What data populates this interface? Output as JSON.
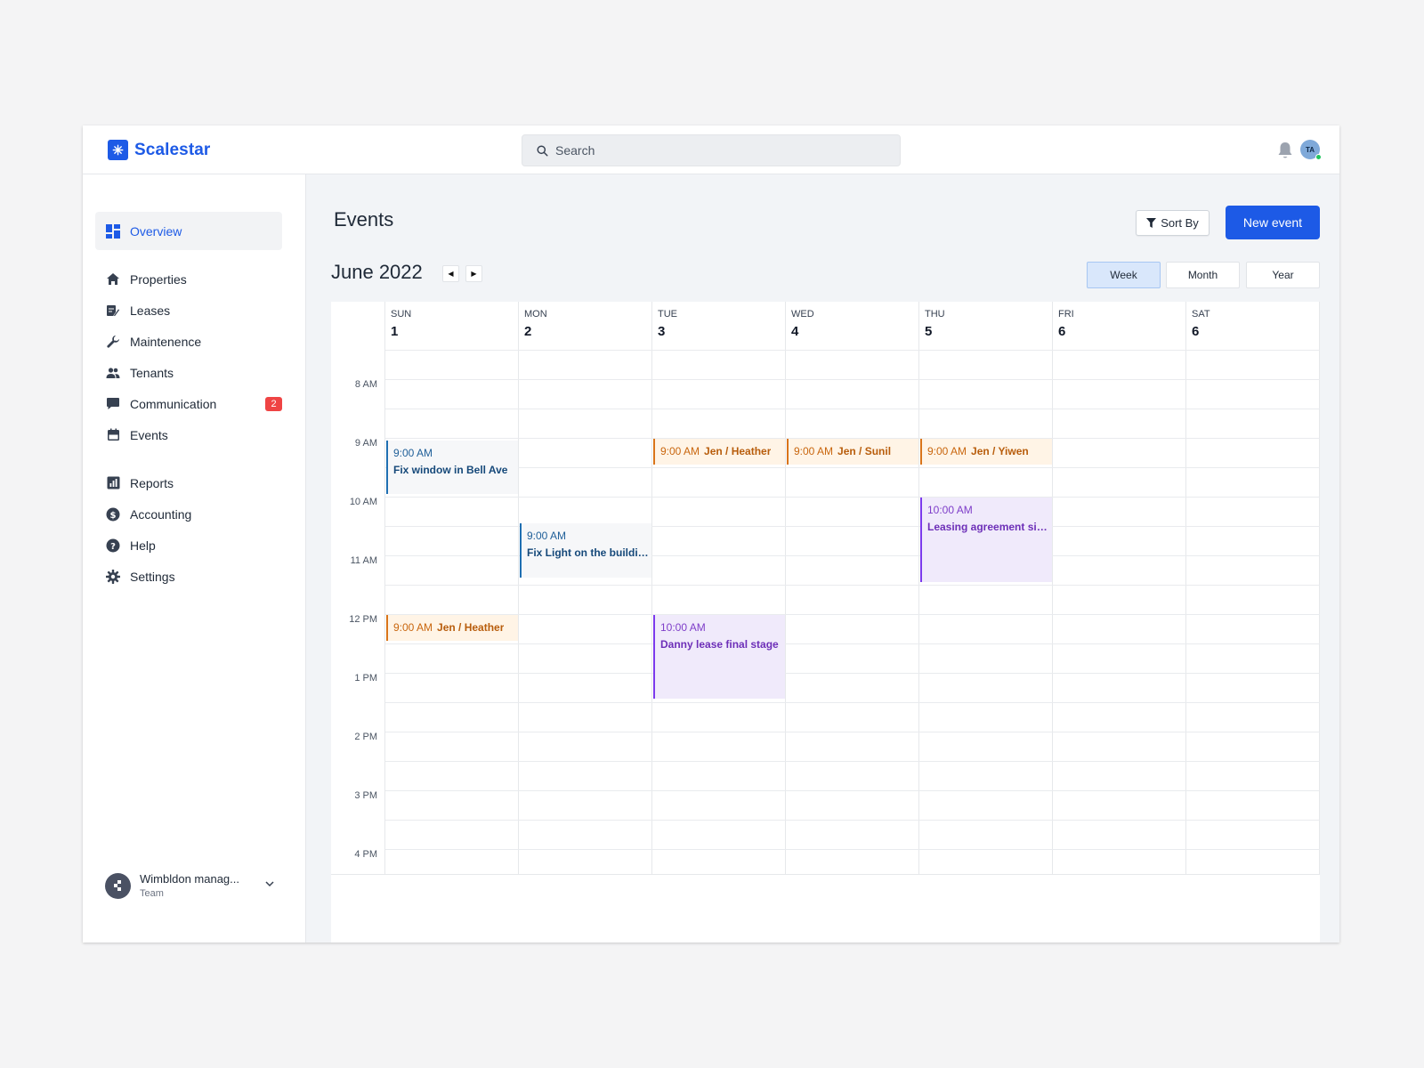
{
  "app": {
    "name": "Scalestar"
  },
  "search": {
    "placeholder": "Search"
  },
  "user": {
    "initials": "TA"
  },
  "sidebar": {
    "items": [
      {
        "label": "Overview",
        "icon": "grid-icon"
      },
      {
        "label": "Properties",
        "icon": "home-icon"
      },
      {
        "label": "Leases",
        "icon": "document-edit-icon"
      },
      {
        "label": "Maintenence",
        "icon": "wrench-icon"
      },
      {
        "label": "Tenants",
        "icon": "people-icon"
      },
      {
        "label": "Communication",
        "icon": "chat-icon",
        "badge": "2"
      },
      {
        "label": "Events",
        "icon": "calendar-icon"
      },
      {
        "label": "Reports",
        "icon": "bar-chart-icon"
      },
      {
        "label": "Accounting",
        "icon": "dollar-icon"
      },
      {
        "label": "Help",
        "icon": "help-icon"
      },
      {
        "label": "Settings",
        "icon": "gear-icon"
      }
    ],
    "team": {
      "name": "Wimbldon manag...",
      "role": "Team"
    }
  },
  "main": {
    "title": "Events",
    "sort_label": "Sort By",
    "new_event_label": "New event",
    "month_label": "June 2022",
    "views": [
      "Week",
      "Month",
      "Year"
    ],
    "active_view": "Week"
  },
  "calendar": {
    "days": [
      {
        "name": "SUN",
        "num": "1"
      },
      {
        "name": "MON",
        "num": "2"
      },
      {
        "name": "TUE",
        "num": "3"
      },
      {
        "name": "WED",
        "num": "4"
      },
      {
        "name": "THU",
        "num": "5"
      },
      {
        "name": "FRI",
        "num": "6"
      },
      {
        "name": "SAT",
        "num": "6"
      }
    ],
    "times": [
      "8 AM",
      "9 AM",
      "10 AM",
      "11 AM",
      "12 PM",
      "1 PM",
      "2 PM",
      "3 PM",
      "4 PM"
    ],
    "events": [
      {
        "time": "9:00 AM",
        "title": "Fix window in Bell Ave"
      },
      {
        "time": "9:00 AM",
        "title": "Fix Light on the buildin..."
      },
      {
        "time": "9:00 AM",
        "title": "Jen / Heather"
      },
      {
        "time": "9:00 AM",
        "title": "Jen / Heather"
      },
      {
        "time": "9:00 AM",
        "title": "Jen / Sunil"
      },
      {
        "time": "9:00 AM",
        "title": "Jen / Yiwen"
      },
      {
        "time": "10:00 AM",
        "title": "Leasing agreement sig..."
      },
      {
        "time": "10:00 AM",
        "title": "Danny lease final stage"
      }
    ]
  },
  "colors": {
    "accent": "#1d5ae6",
    "badge": "#ef4444",
    "event_blue": "#1f6fb2",
    "event_purple": "#7c3aed",
    "event_orange": "#d9741a"
  }
}
